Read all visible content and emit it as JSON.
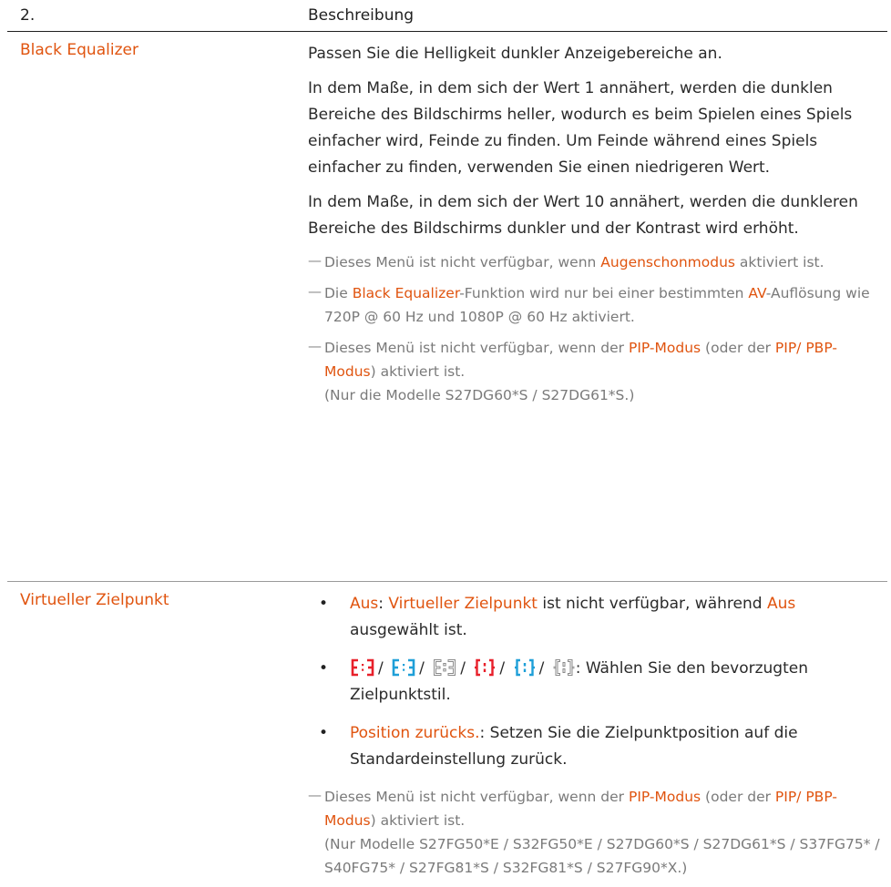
{
  "header": {
    "col1": "2.",
    "col2": "Beschreibung"
  },
  "row1": {
    "term": "Black Equalizer",
    "p1": "Passen Sie die Helligkeit dunkler Anzeigebereiche an.",
    "p2": "In dem Maße, in dem sich der Wert 1 annähert, werden die dunklen Bereiche des Bildschirms heller, wodurch es beim Spielen eines Spiels einfacher wird, Feinde zu finden. Um Feinde während eines Spiels einfacher zu finden, verwenden Sie einen niedrigeren Wert.",
    "p3": "In dem Maße, in dem sich der Wert 10 annähert, werden die dunkleren Bereiche des Bildschirms dunkler und der Kontrast wird erhöht.",
    "note1": {
      "a": "Dieses Menü ist nicht verfügbar, wenn ",
      "b": "Augenschonmodus",
      "c": " aktiviert ist."
    },
    "note2": {
      "a": "Die ",
      "b": "Black Equalizer",
      "c": "-Funktion wird nur bei einer bestimmten ",
      "d": "AV",
      "e": "-Auflösung wie 720P @ 60 Hz und 1080P @ 60 Hz aktiviert."
    },
    "note3": {
      "a": "Dieses Menü ist nicht verfügbar, wenn der ",
      "b": "PIP-Modus",
      "c": " (oder der ",
      "d": "PIP/ PBP-Modus",
      "e": ") aktiviert ist.",
      "f": "(Nur die Modelle S27DG60*S / S27DG61*S.)"
    }
  },
  "row2": {
    "term": "Virtueller Zielpunkt",
    "b1": {
      "a": "Aus",
      "b": ": ",
      "c": "Virtueller Zielpunkt",
      "d": " ist nicht verfügbar, während ",
      "e": "Aus",
      "f": " ausgewählt ist."
    },
    "b2": {
      "sep": "/",
      "text": ": Wählen Sie den bevorzugten Zielpunktstil."
    },
    "b3": {
      "a": "Position zurücks.",
      "b": ": Setzen Sie die Zielpunktposition auf die Standardeinstellung zurück."
    },
    "note": {
      "a": "Dieses Menü ist nicht verfügbar, wenn der ",
      "b": "PIP-Modus",
      "c": " (oder der ",
      "d": "PIP/ PBP-Modus",
      "e": ") aktiviert ist.",
      "f": "(Nur Modelle S27FG50*E / S32FG50*E / S27DG60*S / S27DG61*S / S37FG75* / S40FG75* / S27FG81*S / S32FG81*S / S27FG90*X.)"
    }
  },
  "icons": [
    "crosshair-style-1-icon",
    "crosshair-style-2-icon",
    "crosshair-style-3-icon",
    "crosshair-style-4-icon",
    "crosshair-style-5-icon",
    "crosshair-style-6-icon"
  ],
  "colors": {
    "accent": "#e0540f",
    "note": "#7a7a7a",
    "text": "#2a2a2a",
    "icon_red": "#e8202a",
    "icon_cyan": "#1e9fd8",
    "icon_outline": "#8a8a8a"
  }
}
